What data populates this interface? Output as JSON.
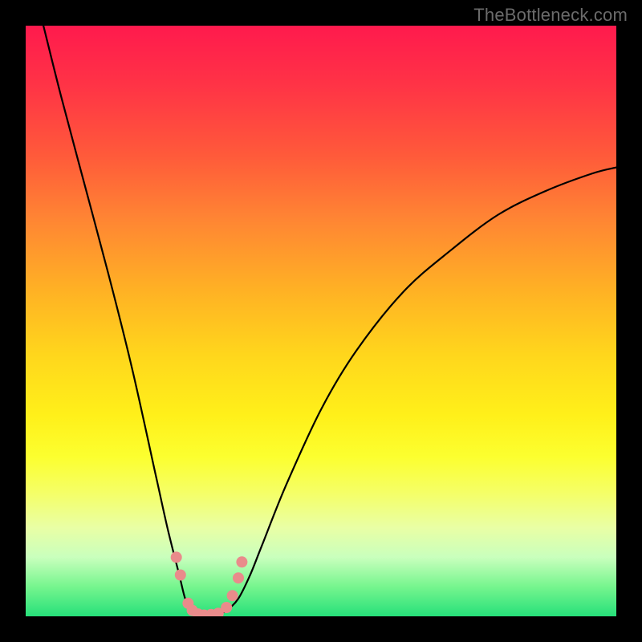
{
  "watermark": "TheBottleneck.com",
  "chart_data": {
    "type": "line",
    "title": "",
    "xlabel": "",
    "ylabel": "",
    "xlim": [
      0,
      100
    ],
    "ylim": [
      0,
      100
    ],
    "grid": false,
    "legend": false,
    "series": [
      {
        "name": "bottleneck-curve",
        "x": [
          3,
          6,
          10,
          14,
          18,
          22,
          24,
          26,
          27,
          28,
          30,
          32,
          34,
          36,
          38,
          40,
          44,
          50,
          56,
          64,
          72,
          80,
          88,
          96,
          100
        ],
        "values": [
          100,
          88,
          73,
          58,
          42,
          24,
          15,
          7,
          3,
          1,
          0,
          0,
          1,
          3,
          7,
          12,
          22,
          35,
          45,
          55,
          62,
          68,
          72,
          75,
          76
        ]
      }
    ],
    "markers": {
      "name": "highlight-points",
      "color": "#e98b8b",
      "points": [
        {
          "x": 25.5,
          "y": 10
        },
        {
          "x": 26.2,
          "y": 7
        },
        {
          "x": 27.5,
          "y": 2.2
        },
        {
          "x": 28.2,
          "y": 1.0
        },
        {
          "x": 29.2,
          "y": 0.4
        },
        {
          "x": 30.2,
          "y": 0.2
        },
        {
          "x": 31.4,
          "y": 0.3
        },
        {
          "x": 32.6,
          "y": 0.5
        },
        {
          "x": 34.0,
          "y": 1.5
        },
        {
          "x": 35.0,
          "y": 3.5
        },
        {
          "x": 36.0,
          "y": 6.5
        },
        {
          "x": 36.6,
          "y": 9.2
        }
      ]
    },
    "background_gradient_stops": [
      {
        "pct": 0,
        "color": "#ff1a4d"
      },
      {
        "pct": 33,
        "color": "#ff8633"
      },
      {
        "pct": 66,
        "color": "#fff01a"
      },
      {
        "pct": 90,
        "color": "#c9ffbd"
      },
      {
        "pct": 100,
        "color": "#26e07a"
      }
    ]
  }
}
